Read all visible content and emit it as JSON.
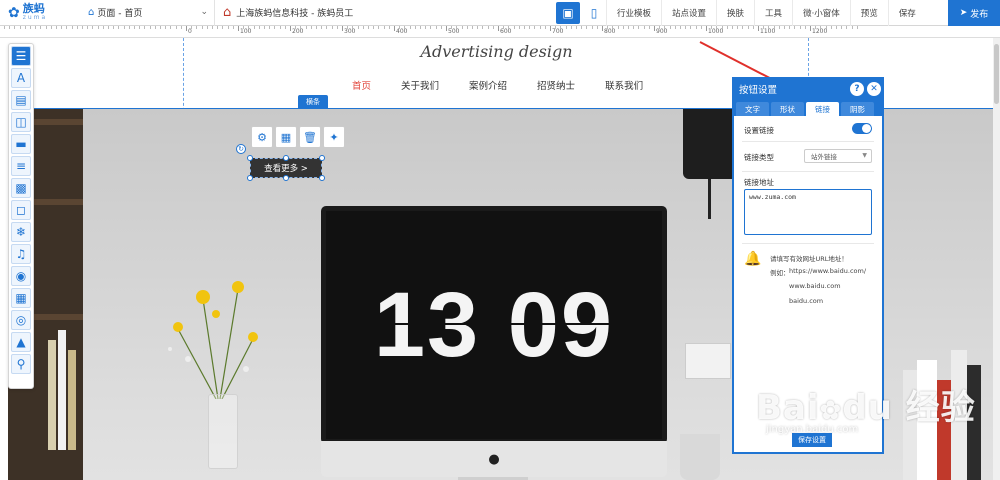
{
  "topbar": {
    "logo_cn": "族蚂",
    "logo_en": "zuma",
    "page_select": "页面 - 首页",
    "site_name": "上海族蚂信息科技 - 族蚂员工",
    "menu": [
      "行业模板",
      "站点设置",
      "换肤",
      "工具",
      "微·小窗体",
      "预览",
      "保存"
    ],
    "publish": "发布"
  },
  "ruler": {
    "labels": [
      "0",
      "100",
      "200",
      "300",
      "400",
      "500",
      "600",
      "700",
      "800",
      "900",
      "1000",
      "1100",
      "1200"
    ]
  },
  "canvas": {
    "brand_title": "Advertising design",
    "nav": [
      "首页",
      "关于我们",
      "案例介绍",
      "招贤纳士",
      "联系我们"
    ],
    "nav_active": 0,
    "strip_label": "横条",
    "clock_text": "13 09",
    "selected_button_text": "查看更多 >"
  },
  "toolbar_icons": [
    "list-icon",
    "text-icon",
    "image-text-icon",
    "shape-icon",
    "line-icon",
    "menu-list-icon",
    "gallery-icon",
    "cart-icon",
    "snowflake-icon",
    "music-icon",
    "video-icon",
    "form-icon",
    "circle-icon",
    "picture-icon",
    "search-zoom-icon"
  ],
  "float_tools": [
    "settings-icon",
    "layout-icon",
    "delete-icon",
    "magic-icon"
  ],
  "panel": {
    "title": "按钮设置",
    "tabs": [
      "文字",
      "形状",
      "链接",
      "阴影"
    ],
    "active_tab": 2,
    "set_link_label": "设置链接",
    "link_type_label": "链接类型",
    "link_type_value": "站外链接",
    "link_url_label": "链接地址",
    "link_url_value": "www.zuma.com",
    "hint_title": "请填写有效网址URL地址！",
    "example_label": "例如：",
    "examples": [
      "https://www.baidu.com/",
      "www.baidu.com",
      "baidu.com"
    ],
    "save_label": "保存设置"
  },
  "watermark": {
    "big": "Bai du 经验",
    "small": "jingyan.baidu.com"
  },
  "colors": {
    "accent": "#1f74d2",
    "active_nav": "#e2463c",
    "arrow": "#e0302b"
  }
}
